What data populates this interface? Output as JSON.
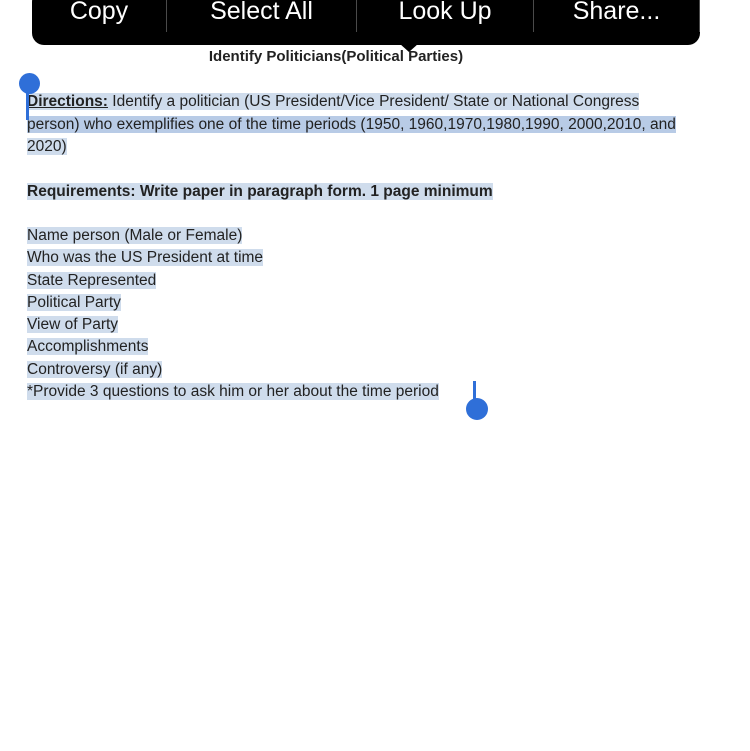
{
  "context_menu": {
    "items": [
      {
        "label": "Copy"
      },
      {
        "label": "Select All"
      },
      {
        "label": "Look Up"
      },
      {
        "label": "Share..."
      }
    ]
  },
  "document": {
    "title": "Identify Politicians(Political Parties)",
    "directions_label": "Directions:",
    "directions_line1": " Identify a politician (US President/Vice President/ State or National Congress",
    "directions_line2": "person) who exemplifies one of the time periods (1950, 1960,1970,1980,1990, 2000,2010, and",
    "directions_line3": "2020)",
    "requirements": "Requirements: Write paper in paragraph form. 1 page minimum",
    "list": [
      "Name person (Male or Female)",
      "Who was the US President at time",
      "State Represented",
      "Political Party",
      "View of Party",
      "Accomplishments",
      "Controversy (if any)",
      "*Provide 3 questions to ask him or her about the time period"
    ]
  },
  "colors": {
    "selection": "#cfdcec",
    "handle": "#2f6fd8",
    "menu_bg": "#000000"
  }
}
